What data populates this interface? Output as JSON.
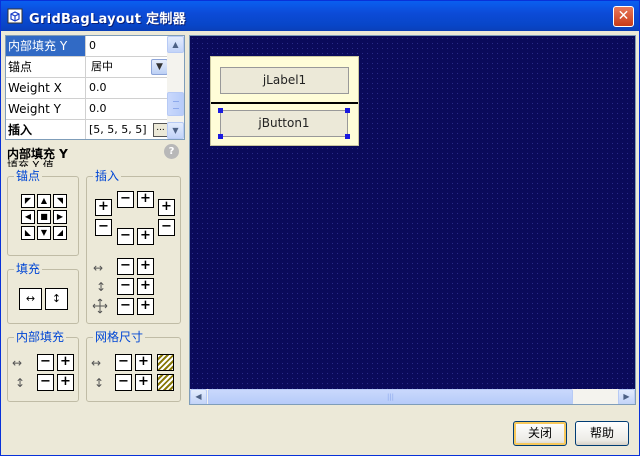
{
  "window": {
    "title": "GridBagLayout 定制器",
    "close_glyph": "✕"
  },
  "properties": [
    {
      "name": "内部填充 Y",
      "value": "0",
      "selected": true
    },
    {
      "name": "锚点",
      "value": "居中",
      "combo": true
    },
    {
      "name": "Weight X",
      "value": "0.0"
    },
    {
      "name": "Weight Y",
      "value": "0.0"
    },
    {
      "name": "插入",
      "value": "[5, 5, 5, 5]",
      "ellipsis": "..."
    }
  ],
  "description": {
    "title": "内部填充 Y",
    "subtitle": "填充 Y 值",
    "help_glyph": "?"
  },
  "groups": {
    "anchor": "锚点",
    "insets": "插入",
    "fill": "填充",
    "ipad": "内部填充",
    "gridsize": "网格尺寸"
  },
  "anchor_glyphs": [
    "◤",
    "▲",
    "◥",
    "◀",
    "■",
    "▶",
    "◣",
    "▼",
    "◢"
  ],
  "fill_glyphs": {
    "horizontal": "↔",
    "vertical": "↕"
  },
  "stepper": {
    "plus": "+",
    "minus": "−"
  },
  "canvas": {
    "label": "jLabel1",
    "button": "jButton1"
  },
  "scroll_glyphs": {
    "up": "▲",
    "down": "▼",
    "left": "◀",
    "right": "▶",
    "grip": "|||"
  },
  "buttons": {
    "close": "关闭",
    "help": "帮助"
  },
  "colors": {
    "title_bar": "#0A5FF0",
    "selection": "#316AC5",
    "canvas_bg": "#0A0A5A",
    "group_label": "#0046D5"
  }
}
